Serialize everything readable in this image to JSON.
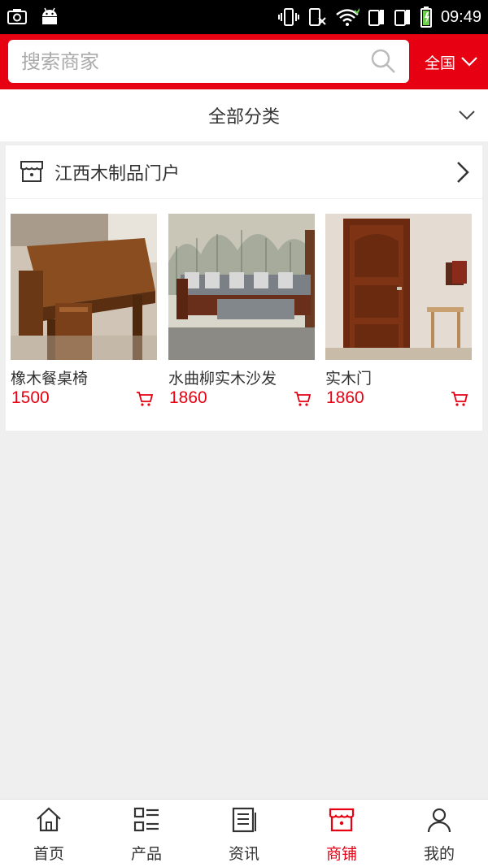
{
  "status_bar": {
    "time": "09:49",
    "left_icons": [
      "screenshot-icon",
      "android-icon"
    ],
    "right_icons": [
      "vibrate-icon",
      "call-icon",
      "wifi-icon",
      "sim1-signal-icon",
      "sim2-signal-icon",
      "battery-charging-icon"
    ]
  },
  "header": {
    "search_placeholder": "搜索商家",
    "region_label": "全国",
    "accent_color": "#e60012"
  },
  "category": {
    "label": "全部分类"
  },
  "store": {
    "name": "江西木制品门户",
    "products": [
      {
        "name": "橡木餐桌椅",
        "price": "1500",
        "image": "dining-table-photo"
      },
      {
        "name": "水曲柳实木沙发",
        "price": "1860",
        "image": "wooden-sofa-photo"
      },
      {
        "name": "实木门",
        "price": "1860",
        "image": "wooden-door-photo"
      }
    ]
  },
  "tabbar": {
    "active": "商铺",
    "items": [
      {
        "label": "首页",
        "icon": "home-icon"
      },
      {
        "label": "产品",
        "icon": "list-grid-icon"
      },
      {
        "label": "资讯",
        "icon": "news-icon"
      },
      {
        "label": "商铺",
        "icon": "store-icon"
      },
      {
        "label": "我的",
        "icon": "user-icon"
      }
    ]
  }
}
